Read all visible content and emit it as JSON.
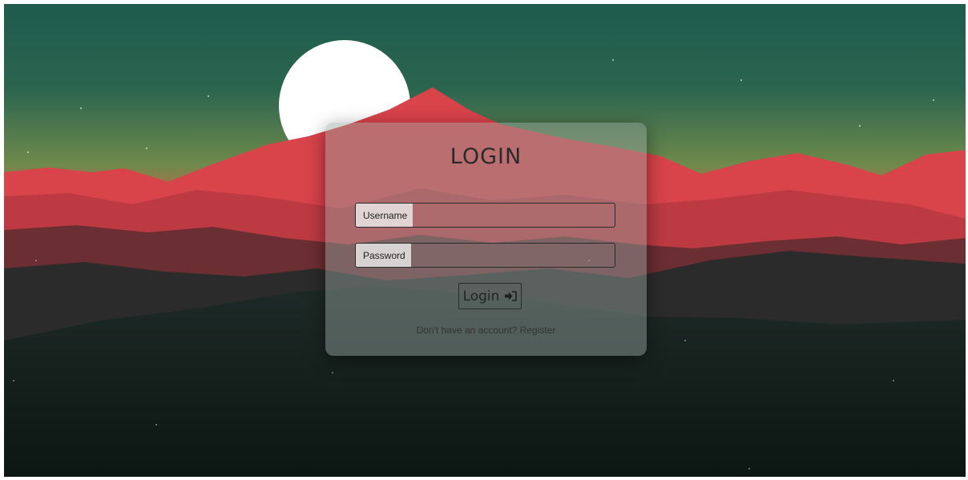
{
  "login": {
    "title": "LOGIN",
    "username_label": "Username",
    "username_value": "",
    "password_label": "Password",
    "password_value": "",
    "submit_label": "Login",
    "register_prompt": "Don't have an account?",
    "register_link": "Register"
  },
  "icons": {
    "submit": "sign-in-icon"
  },
  "colors": {
    "sky_top": "#1d5a4d",
    "sky_horizon": "#7a8d4b",
    "mountain_red": "#d9424a",
    "moon": "#ffffff",
    "ground_dark": "#0f1c18"
  }
}
